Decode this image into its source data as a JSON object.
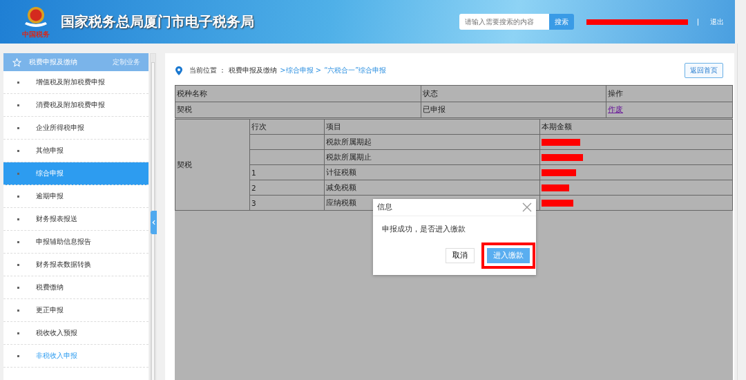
{
  "header": {
    "title": "国家税务总局厦门市电子税务局",
    "logo_caption": "中国税务",
    "search": {
      "placeholder": "请输入需要搜索的内容",
      "button": "搜索"
    },
    "user_redacted": true,
    "logout": "退出"
  },
  "sidebar": {
    "title": "税费申报及缴纳",
    "custom_link": "定制业务",
    "items": [
      {
        "label": "增值税及附加税费申报",
        "selected": false,
        "hovered": false
      },
      {
        "label": "消费税及附加税费申报",
        "selected": false,
        "hovered": false
      },
      {
        "label": "企业所得税申报",
        "selected": false,
        "hovered": false
      },
      {
        "label": "其他申报",
        "selected": false,
        "hovered": false
      },
      {
        "label": "综合申报",
        "selected": true,
        "hovered": false
      },
      {
        "label": "逾期申报",
        "selected": false,
        "hovered": false
      },
      {
        "label": "财务报表报送",
        "selected": false,
        "hovered": false
      },
      {
        "label": "申报辅助信息报告",
        "selected": false,
        "hovered": false
      },
      {
        "label": "财务报表数据转换",
        "selected": false,
        "hovered": false
      },
      {
        "label": "税费缴纳",
        "selected": false,
        "hovered": false
      },
      {
        "label": "更正申报",
        "selected": false,
        "hovered": false
      },
      {
        "label": "税收收入预报",
        "selected": false,
        "hovered": false
      },
      {
        "label": "非税收入申报",
        "selected": false,
        "hovered": true
      }
    ]
  },
  "breadcrumb": {
    "label": "当前位置 ：",
    "items": [
      {
        "text": "税费申报及缴纳",
        "link": false
      },
      {
        "text": ">综合申报 >",
        "link": true
      },
      {
        "text": "“六税合一”综合申报",
        "link": true
      }
    ]
  },
  "home_button": "返回首页",
  "summary_table": {
    "columns": [
      "税种名称",
      "状态",
      "操作"
    ],
    "rows": [
      {
        "name": "契税",
        "status": "已申报",
        "action": "作废"
      }
    ]
  },
  "detail_table": {
    "group_label": "契税",
    "columns": [
      "行次",
      "项目",
      "本期金额"
    ],
    "rows": [
      {
        "line": "",
        "item": "税款所属期起",
        "amount_redacted": true
      },
      {
        "line": "",
        "item": "税款所属期止",
        "amount_redacted": true
      },
      {
        "line": "1",
        "item": "计征税额",
        "amount_redacted": true
      },
      {
        "line": "2",
        "item": "减免税额",
        "amount_redacted": true
      },
      {
        "line": "3",
        "item": "应纳税额",
        "amount_redacted": true
      }
    ]
  },
  "dialog": {
    "title": "信息",
    "message": "申报成功，是否进入缴款",
    "cancel": "取消",
    "confirm": "进入缴款",
    "confirm_highlighted": true
  }
}
